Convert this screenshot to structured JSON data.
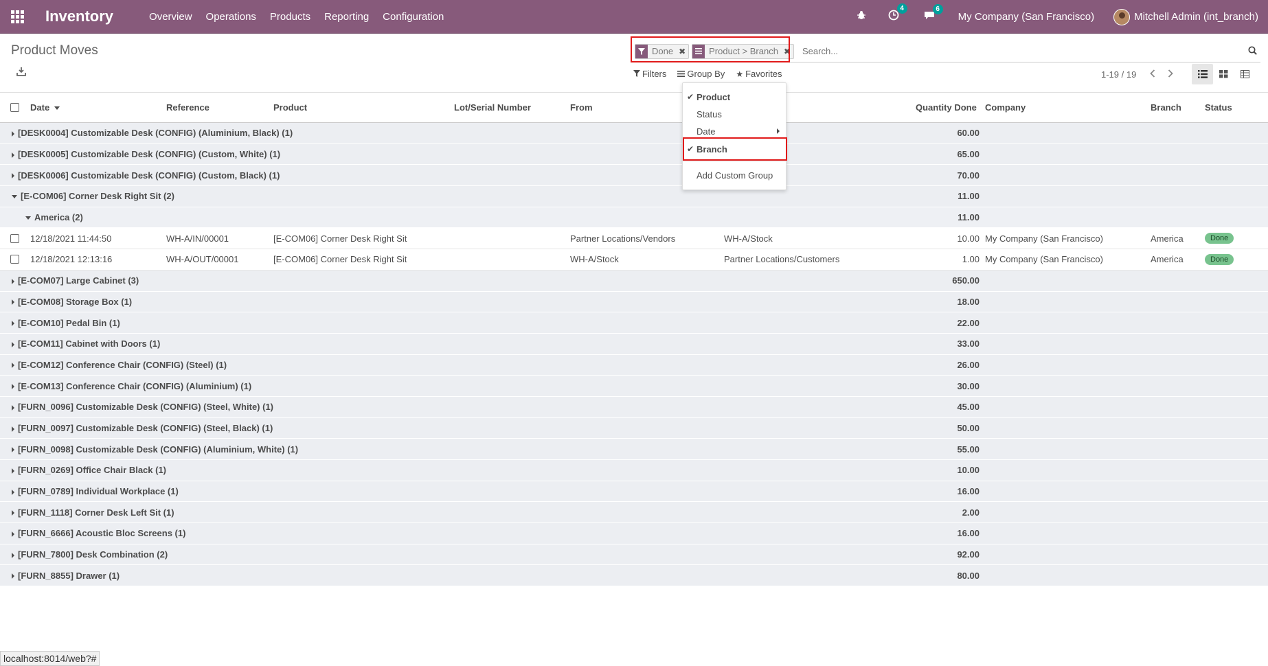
{
  "navbar": {
    "app_name": "Inventory",
    "menu": [
      "Overview",
      "Operations",
      "Products",
      "Reporting",
      "Configuration"
    ],
    "activity_badge": "4",
    "messages_badge": "6",
    "company": "My Company (San Francisco)",
    "user": "Mitchell Admin (int_branch)"
  },
  "control_panel": {
    "title": "Product Moves",
    "facets": [
      {
        "icon": "filter-icon",
        "label": "Done"
      },
      {
        "icon": "groupby-icon",
        "label": "Product > Branch"
      }
    ],
    "search_placeholder": "Search...",
    "filters_label": "Filters",
    "groupby_label": "Group By",
    "favorites_label": "Favorites",
    "pager": "1-19 / 19"
  },
  "dropdown": {
    "items": [
      "Product",
      "Status",
      "Date",
      "Branch"
    ],
    "add_custom": "Add Custom Group"
  },
  "table": {
    "headers": [
      "Date",
      "Reference",
      "Product",
      "Lot/Serial Number",
      "From",
      "Quantity Done",
      "Company",
      "Branch",
      "Status"
    ],
    "groups_before": [
      {
        "label": "[DESK0004] Customizable Desk (CONFIG) (Aluminium, Black) (1)",
        "qty": "60.00"
      },
      {
        "label": "[DESK0005] Customizable Desk (CONFIG) (Custom, White) (1)",
        "qty": "65.00"
      },
      {
        "label": "[DESK0006] Customizable Desk (CONFIG) (Custom, Black) (1)",
        "qty": "70.00"
      }
    ],
    "open_group": {
      "label": "[E-COM06] Corner Desk Right Sit (2)",
      "qty": "11.00"
    },
    "sub_group": {
      "label": "America (2)",
      "qty": "11.00"
    },
    "rows": [
      {
        "date": "12/18/2021 11:44:50",
        "reference": "WH-A/IN/00001",
        "product": "[E-COM06] Corner Desk Right Sit",
        "from": "Partner Locations/Vendors",
        "to": "WH-A/Stock",
        "qty": "10.00",
        "company": "My Company (San Francisco)",
        "branch": "America",
        "status": "Done"
      },
      {
        "date": "12/18/2021 12:13:16",
        "reference": "WH-A/OUT/00001",
        "product": "[E-COM06] Corner Desk Right Sit",
        "from": "WH-A/Stock",
        "to": "Partner Locations/Customers",
        "qty": "1.00",
        "company": "My Company (San Francisco)",
        "branch": "America",
        "status": "Done"
      }
    ],
    "groups_after": [
      {
        "label": "[E-COM07] Large Cabinet (3)",
        "qty": "650.00"
      },
      {
        "label": "[E-COM08] Storage Box (1)",
        "qty": "18.00"
      },
      {
        "label": "[E-COM10] Pedal Bin (1)",
        "qty": "22.00"
      },
      {
        "label": "[E-COM11] Cabinet with Doors (1)",
        "qty": "33.00"
      },
      {
        "label": "[E-COM12] Conference Chair (CONFIG) (Steel) (1)",
        "qty": "26.00"
      },
      {
        "label": "[E-COM13] Conference Chair (CONFIG) (Aluminium) (1)",
        "qty": "30.00"
      },
      {
        "label": "[FURN_0096] Customizable Desk (CONFIG) (Steel, White) (1)",
        "qty": "45.00"
      },
      {
        "label": "[FURN_0097] Customizable Desk (CONFIG) (Steel, Black) (1)",
        "qty": "50.00"
      },
      {
        "label": "[FURN_0098] Customizable Desk (CONFIG) (Aluminium, White) (1)",
        "qty": "55.00"
      },
      {
        "label": "[FURN_0269] Office Chair Black (1)",
        "qty": "10.00"
      },
      {
        "label": "[FURN_0789] Individual Workplace (1)",
        "qty": "16.00"
      },
      {
        "label": "[FURN_1118] Corner Desk Left Sit (1)",
        "qty": "2.00"
      },
      {
        "label": "[FURN_6666] Acoustic Bloc Screens (1)",
        "qty": "16.00"
      },
      {
        "label": "[FURN_7800] Desk Combination (2)",
        "qty": "92.00"
      },
      {
        "label": "[FURN_8855] Drawer (1)",
        "qty": "80.00"
      }
    ]
  },
  "status_url": "localhost:8014/web?#",
  "colors": {
    "brand": "#875a7b",
    "badge": "#00a09d",
    "done": "#78c38e",
    "highlight": "#e11b1b"
  }
}
